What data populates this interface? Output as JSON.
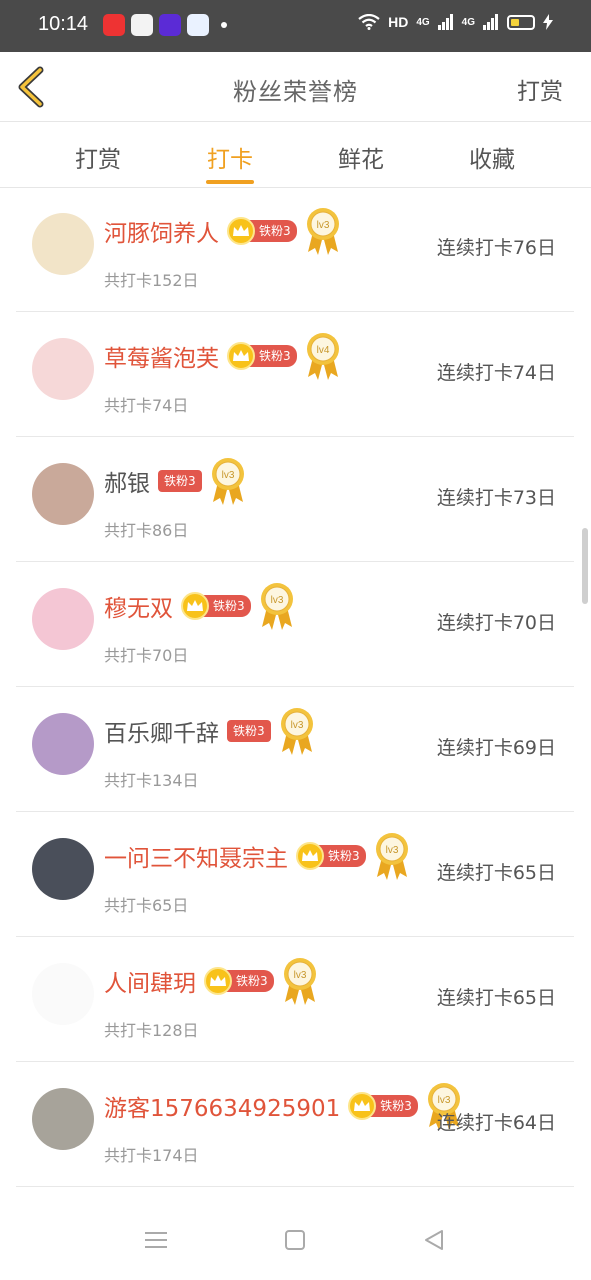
{
  "status_bar": {
    "time": "10:14",
    "hd": "HD",
    "net1": "4G",
    "net2": "4G"
  },
  "header": {
    "title": "粉丝荣誉榜",
    "action": "打赏"
  },
  "tabs": [
    {
      "label": "打赏",
      "active": false
    },
    {
      "label": "打卡",
      "active": true
    },
    {
      "label": "鲜花",
      "active": false
    },
    {
      "label": "收藏",
      "active": false
    }
  ],
  "colors": {
    "accent": "#f0a020",
    "name_highlight": "#e0543a",
    "badge": "#e2574c",
    "medal": "#f3c33d"
  },
  "rows": [
    {
      "name": "河豚饲养人",
      "crown": true,
      "badge": "铁粉3",
      "medal": "lv3",
      "total": "共打卡152日",
      "streak": "连续打卡76日",
      "highlight": true,
      "avatar_color": "#f2e4c8"
    },
    {
      "name": "草莓酱泡芙",
      "crown": true,
      "badge": "铁粉3",
      "medal": "lv4",
      "total": "共打卡74日",
      "streak": "连续打卡74日",
      "highlight": true,
      "avatar_color": "#f6d8d8"
    },
    {
      "name": "郝银",
      "crown": false,
      "badge": "铁粉3",
      "medal": "lv3",
      "total": "共打卡86日",
      "streak": "连续打卡73日",
      "highlight": false,
      "avatar_color": "#c9a99a"
    },
    {
      "name": "穆无双",
      "crown": true,
      "badge": "铁粉3",
      "medal": "lv3",
      "total": "共打卡70日",
      "streak": "连续打卡70日",
      "highlight": true,
      "avatar_color": "#f4c6d4"
    },
    {
      "name": "百乐卿千辞",
      "crown": false,
      "badge": "铁粉3",
      "medal": "lv3",
      "total": "共打卡134日",
      "streak": "连续打卡69日",
      "highlight": false,
      "avatar_color": "#b59ac8"
    },
    {
      "name": "一问三不知聂宗主",
      "crown": true,
      "badge": "铁粉3",
      "medal": "lv3",
      "total": "共打卡65日",
      "streak": "连续打卡65日",
      "highlight": true,
      "avatar_color": "#4a4f5a"
    },
    {
      "name": "人间肆玥",
      "crown": true,
      "badge": "铁粉3",
      "medal": "lv3",
      "total": "共打卡128日",
      "streak": "连续打卡65日",
      "highlight": true,
      "avatar_color": "#fafafa"
    },
    {
      "name": "游客1576634925901",
      "crown": true,
      "badge": "铁粉3",
      "medal": "lv3",
      "total": "共打卡174日",
      "streak": "连续打卡64日",
      "highlight": true,
      "avatar_color": "#a7a39a"
    }
  ]
}
